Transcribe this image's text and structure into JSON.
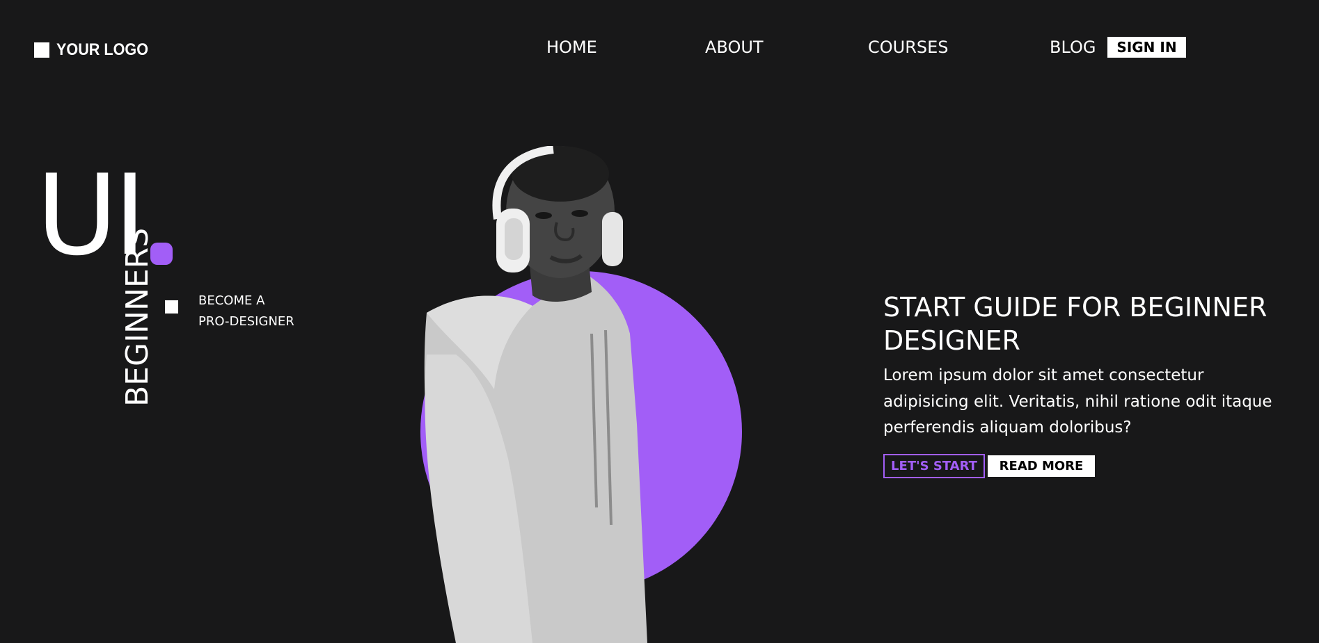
{
  "header": {
    "logo_text": "YOUR LOGO",
    "nav": [
      {
        "label": "HOME"
      },
      {
        "label": "ABOUT"
      },
      {
        "label": "COURSES"
      },
      {
        "label": "BLOG"
      }
    ],
    "signin_label": "SIGN IN"
  },
  "hero": {
    "big_text": "UI",
    "vertical_text": "BEGINNERS",
    "tagline_line1": "BECOME A",
    "tagline_line2": "PRO-DESIGNER",
    "headline": "START GUIDE FOR BEGINNER DESIGNER",
    "body": "Lorem ipsum dolor sit amet consectetur adipisicing elit. Veritatis, nihil ratione odit itaque perferendis aliquam doloribus?",
    "primary_button": "LET'S START",
    "secondary_button": "READ MORE"
  },
  "colors": {
    "background": "#181819",
    "accent": "#a25ef7",
    "text": "#ffffff"
  },
  "icons": {
    "logo_mark": "square-logo-icon",
    "accent_dot": "rounded-dot-icon",
    "bullet": "square-bullet-icon"
  }
}
